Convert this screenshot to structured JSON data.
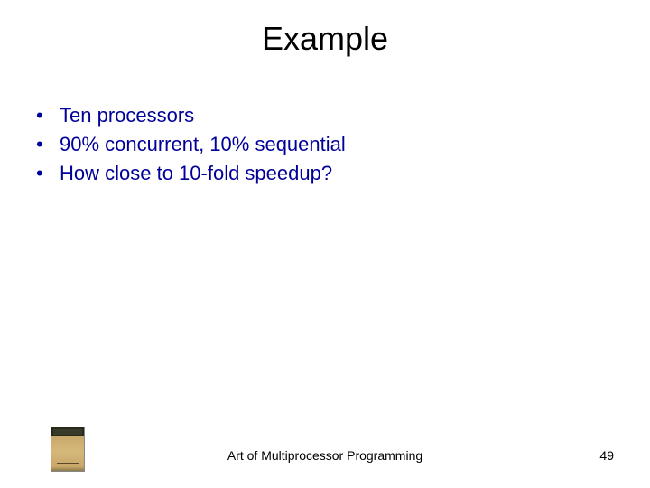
{
  "title": "Example",
  "bullets": [
    "Ten processors",
    "90% concurrent, 10% sequential",
    "How close to 10-fold speedup?"
  ],
  "footer": {
    "text": "Art of Multiprocessor Programming",
    "page_number": "49"
  },
  "icon": "book-cover-icon"
}
